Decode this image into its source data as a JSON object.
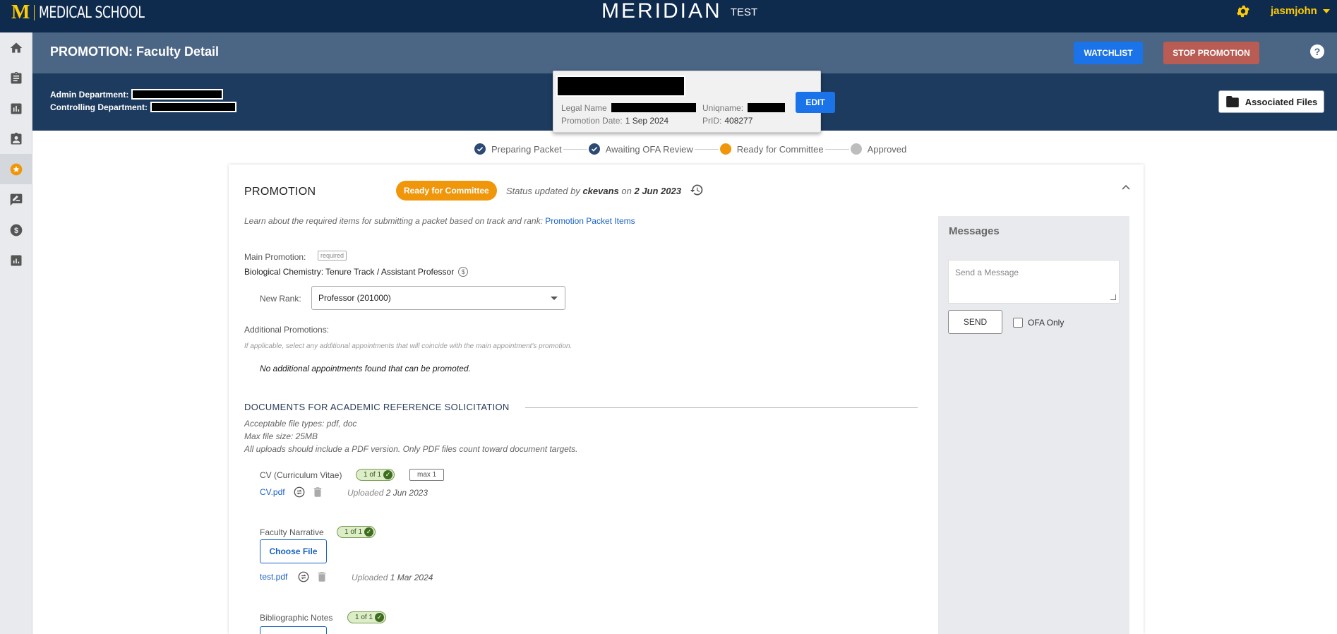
{
  "topbar": {
    "brand_mark": "M",
    "brand_text": "MEDICAL SCHOOL",
    "app_name": "MERIDIAN",
    "env_label": "TEST",
    "user_name": "jasmjohn",
    "accent_color": "#ffcb05"
  },
  "sidebar": {
    "items": [
      {
        "name": "home-icon"
      },
      {
        "name": "clipboard-icon"
      },
      {
        "name": "bar-chart-icon"
      },
      {
        "name": "badge-icon"
      },
      {
        "name": "star-circle-icon",
        "active": true
      },
      {
        "name": "signature-icon"
      },
      {
        "name": "dollar-icon"
      },
      {
        "name": "report-icon"
      }
    ]
  },
  "header": {
    "title": "PROMOTION: Faculty Detail",
    "watchlist_label": "WATCHLIST",
    "stop_label": "STOP PROMOTION",
    "help_label": "?",
    "admin_dept_label": "Admin Department:",
    "controlling_dept_label": "Controlling Department:",
    "files_label": "Associated Files"
  },
  "faculty_card": {
    "legal_name_label": "Legal Name",
    "uniqname_label": "Uniqname:",
    "promotion_date_label": "Promotion Date:",
    "promotion_date_value": "1 Sep 2024",
    "prid_label": "PrID:",
    "prid_value": "408277",
    "edit_label": "EDIT"
  },
  "steps": [
    {
      "label": "Preparing Packet",
      "state": "done"
    },
    {
      "label": "Awaiting OFA Review",
      "state": "done"
    },
    {
      "label": "Ready for Committee",
      "state": "current"
    },
    {
      "label": "Approved",
      "state": "todo"
    }
  ],
  "promotion": {
    "title": "PROMOTION",
    "status": "Ready for Committee",
    "status_prefix": "Status updated by",
    "status_user": "ckevans",
    "status_on": "on",
    "status_date": "2 Jun 2023",
    "intro_text": "Learn about the required items for submitting a packet based on track and rank:",
    "intro_link": "Promotion Packet Items",
    "main_label": "Main Promotion:",
    "required_tag": "required",
    "main_value": "Biological Chemistry: Tenure Track / Assistant Professor",
    "dollar_glyph": "$",
    "new_rank_label": "New Rank:",
    "new_rank_value": "Professor (201000)",
    "additional_label": "Additional Promotions:",
    "additional_hint": "If applicable, select any additional appointments that will coincide with the main appointment's promotion.",
    "no_additional": "No additional appointments found that can be promoted."
  },
  "documents": {
    "heading": "DOCUMENTS FOR ACADEMIC REFERENCE SOLICITATION",
    "note1": "Acceptable file types: pdf, doc",
    "note2": "Max file size: 25MB",
    "note3": "All uploads should include a PDF version. Only PDF files count toward document targets.",
    "choose_label": "Choose File",
    "uploaded_prefix": "Uploaded",
    "items": [
      {
        "label": "CV (Curriculum Vitae)",
        "count": "1 of 1",
        "max": "max 1",
        "file": "CV.pdf",
        "uploaded": "2 Jun 2023"
      },
      {
        "label": "Faculty Narrative",
        "count": "1 of 1",
        "file": "test.pdf",
        "uploaded": "1 Mar 2024"
      },
      {
        "label": "Bibliographic Notes",
        "count": "1 of 1"
      }
    ]
  },
  "messages": {
    "title": "Messages",
    "placeholder": "Send a Message",
    "send_label": "SEND",
    "ofa_only_label": "OFA Only"
  }
}
